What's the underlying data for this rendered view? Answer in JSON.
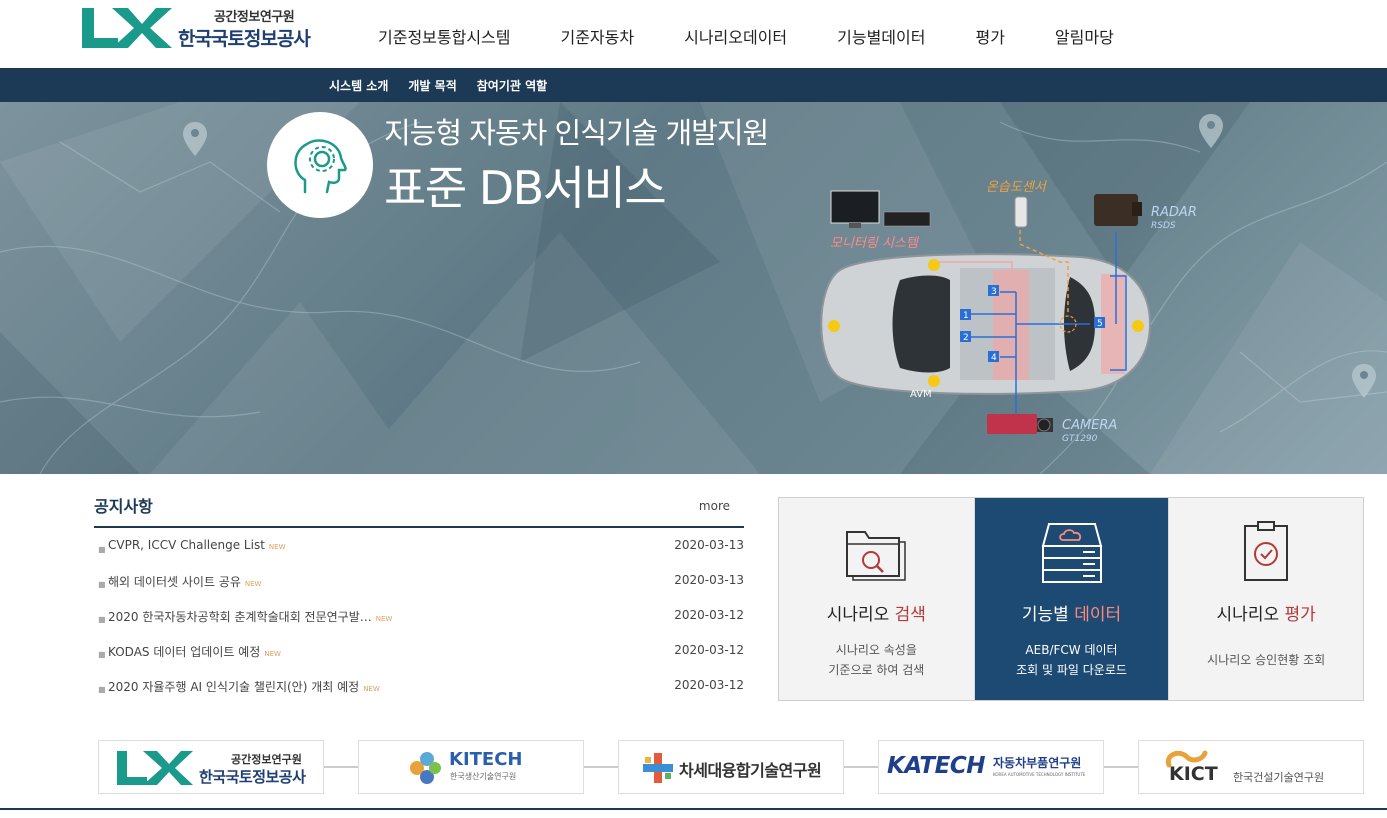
{
  "header": {
    "logo_sub": "공간정보연구원",
    "logo_main": "한국국토정보공사",
    "nav": [
      "기준정보통합시스템",
      "기준자동차",
      "시나리오데이터",
      "기능별데이터",
      "평가",
      "알림마당"
    ]
  },
  "subnav": [
    "시스템 소개",
    "개발 목적",
    "참여기관 역할"
  ],
  "hero": {
    "title_line1": "지능형 자동차 인식기술 개발지원",
    "title_line2": "표준 DB서비스",
    "labels": {
      "monitoring": "모니터링 시스템",
      "temp_sensor": "온습도센서",
      "radar": "RADAR",
      "radar_model": "RSDS",
      "camera": "CAMERA",
      "camera_model": "GT1290",
      "avm": "AVM"
    },
    "sensor_numbers": [
      "1",
      "2",
      "3",
      "4",
      "5"
    ]
  },
  "notice": {
    "title": "공지사항",
    "more": "more",
    "new_tag": "NEW",
    "items": [
      {
        "title": "CVPR, ICCV Challenge List",
        "date": "2020-03-13"
      },
      {
        "title": "해외 데이터셋 사이트 공유",
        "date": "2020-03-13"
      },
      {
        "title": "2020 한국자동차공학회 춘계학술대회 전문연구발…",
        "date": "2020-03-12"
      },
      {
        "title": "KODAS 데이터 업데이트 예정",
        "date": "2020-03-12"
      },
      {
        "title": "2020 자율주행 AI 인식기술 챌린지(안) 개최 예정",
        "date": "2020-03-12"
      }
    ]
  },
  "boxes": [
    {
      "title_a": "시나리오 ",
      "title_b": "검색",
      "desc1": "시나리오 속성을",
      "desc2": "기준으로 하여 검색"
    },
    {
      "title_a": "기능별 ",
      "title_b": "데이터",
      "desc1": "AEB/FCW 데이터",
      "desc2": "조회 및 파일 다운로드"
    },
    {
      "title_a": "시나리오 ",
      "title_b": "평가",
      "desc1": "시나리오 승인현황 조회",
      "desc2": ""
    }
  ],
  "partners": {
    "lx_sub": "공간정보연구원",
    "lx_main": "한국국토정보공사",
    "kitech": "KITECH",
    "kitech_sub": "한국생산기술연구원",
    "ccrc": "차세대융합기술연구원",
    "katech": "KATECH",
    "katech_sub": "자동차부품연구원",
    "katech_en": "KOREA AUTOMOTIVE TECHNOLOGY INSTITUTE",
    "kict": "KICT",
    "kict_sub": "한국건설기술연구원"
  },
  "colors": {
    "navy": "#1c3a56",
    "brand_green": "#1a9a8a",
    "accent_red": "#b23a3a"
  }
}
